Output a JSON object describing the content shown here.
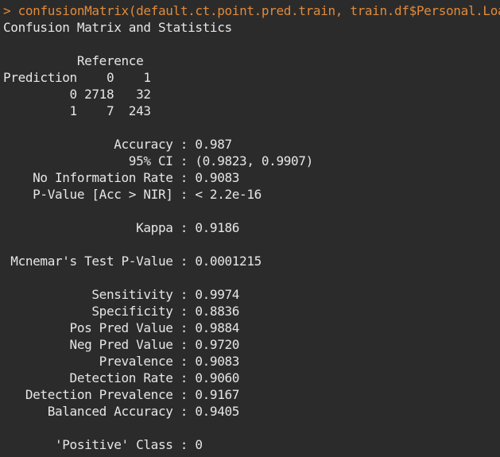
{
  "console": {
    "prompt_symbol": ">",
    "command": "confusionMatrix(default.ct.point.pred.train, train.df$Personal.Loan)",
    "output": [
      "Confusion Matrix and Statistics",
      "",
      "          Reference",
      "Prediction    0    1",
      "         0 2718   32",
      "         1    7  243",
      "",
      "               Accuracy : 0.987",
      "                 95% CI : (0.9823, 0.9907)",
      "    No Information Rate : 0.9083",
      "    P-Value [Acc > NIR] : < 2.2e-16",
      "",
      "                  Kappa : 0.9186",
      "",
      " Mcnemar's Test P-Value : 0.0001215",
      "",
      "            Sensitivity : 0.9974",
      "            Specificity : 0.8836",
      "         Pos Pred Value : 0.9884",
      "         Neg Pred Value : 0.9720",
      "             Prevalence : 0.9083",
      "         Detection Rate : 0.9060",
      "   Detection Prevalence : 0.9167",
      "      Balanced Accuracy : 0.9405",
      "",
      "       'Positive' Class : 0"
    ]
  },
  "colors": {
    "background": "#2b2b2b",
    "text": "#e6e6e6",
    "command": "#e08a3a"
  }
}
